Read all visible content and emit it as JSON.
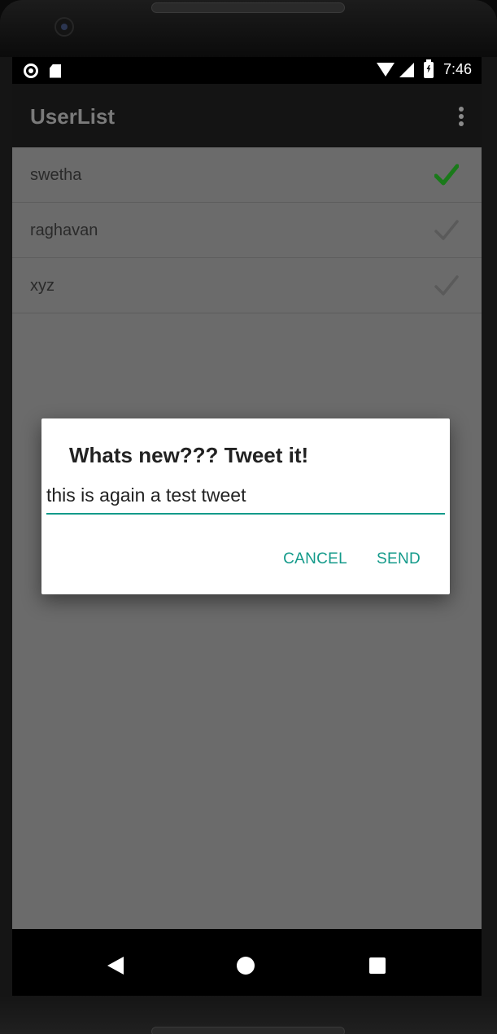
{
  "status_bar": {
    "time": "7:46",
    "icons": [
      "record-icon",
      "sd-card-icon",
      "wifi-icon",
      "signal-icon",
      "battery-charging-icon"
    ]
  },
  "app_bar": {
    "title": "UserList",
    "menu_icon": "overflow-menu-icon"
  },
  "users": [
    {
      "name": "swetha",
      "checked": true
    },
    {
      "name": "raghavan",
      "checked": false
    },
    {
      "name": "xyz",
      "checked": false
    }
  ],
  "dialog": {
    "title": "Whats new??? Tweet it!",
    "input_value": "this is again a test tweet",
    "cancel_label": "CANCEL",
    "send_label": "SEND"
  },
  "nav_bar": {
    "icons": [
      "back-icon",
      "home-icon",
      "recents-icon"
    ]
  },
  "colors": {
    "accent": "#139a8a",
    "checked": "#1a7a1a",
    "unchecked": "#5a5a5a",
    "scrim_bg": "#6b6b6b"
  }
}
